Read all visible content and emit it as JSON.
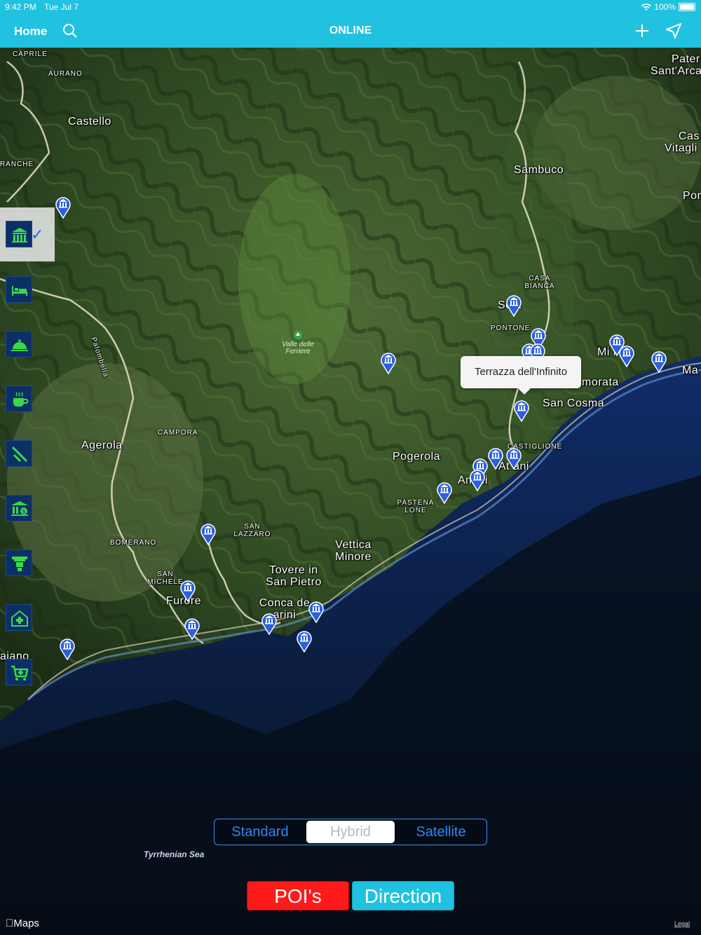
{
  "status_bar": {
    "time": "9:42 PM",
    "date": "Tue Jul 7",
    "battery": "100%"
  },
  "nav": {
    "home_label": "Home",
    "title": "ONLINE",
    "search_icon": "search-icon",
    "add_icon": "plus-icon",
    "locate_icon": "location-arrow-icon"
  },
  "map": {
    "labels": [
      {
        "text": "CAPRILE",
        "kind": "small"
      },
      {
        "text": "AURANO",
        "kind": "small"
      },
      {
        "text": "Castello",
        "kind": "big"
      },
      {
        "text": "RANCHE",
        "kind": "small"
      },
      {
        "text": "Sambuco",
        "kind": "big"
      },
      {
        "text": "Pater",
        "kind": "big"
      },
      {
        "text": "Sant'Arca",
        "kind": "big"
      },
      {
        "text": "Cas",
        "kind": "big"
      },
      {
        "text": "Vitagli",
        "kind": "big"
      },
      {
        "text": "Por",
        "kind": "big"
      },
      {
        "text": "CASA BIANCA",
        "kind": "small"
      },
      {
        "text": "Sc a",
        "kind": "big"
      },
      {
        "text": "PONTONE",
        "kind": "small"
      },
      {
        "text": "Mi  i",
        "kind": "big"
      },
      {
        "text": "Ma",
        "kind": "big"
      },
      {
        "text": "morata",
        "kind": "big"
      },
      {
        "text": "San Cosma",
        "kind": "big"
      },
      {
        "text": "CASTIGLIONE",
        "kind": "small"
      },
      {
        "text": "At ani",
        "kind": "big"
      },
      {
        "text": "Pogerola",
        "kind": "big"
      },
      {
        "text": "Am  lfi",
        "kind": "big"
      },
      {
        "text": "PASTENA LONE",
        "kind": "small"
      },
      {
        "text": "Agerola",
        "kind": "big"
      },
      {
        "text": "CAMPORA",
        "kind": "small"
      },
      {
        "text": "Palombella",
        "kind": "small"
      },
      {
        "text": "SAN LAZZARO",
        "kind": "small"
      },
      {
        "text": "BOMERANO",
        "kind": "small"
      },
      {
        "text": "Vettica Minore",
        "kind": "big"
      },
      {
        "text": "Tovere in San Pietro",
        "kind": "big"
      },
      {
        "text": "SAN MICHELE",
        "kind": "small"
      },
      {
        "text": "Furore",
        "kind": "big"
      },
      {
        "text": "Conca de  arini",
        "kind": "big"
      },
      {
        "text": "aiano",
        "kind": "big"
      }
    ],
    "park_label": "Valle delle Ferriere",
    "sea_label": "Tyrrhenian Sea",
    "callout_text": "Terrazza dell'Infinito"
  },
  "categories": [
    {
      "name": "museum-icon",
      "selected": true
    },
    {
      "name": "bed-icon",
      "selected": false
    },
    {
      "name": "restaurant-bell-icon",
      "selected": false
    },
    {
      "name": "coffee-icon",
      "selected": false
    },
    {
      "name": "fork-knife-icon",
      "selected": false
    },
    {
      "name": "bank-icon",
      "selected": false
    },
    {
      "name": "atm-icon",
      "selected": false
    },
    {
      "name": "hospital-icon",
      "selected": false
    },
    {
      "name": "shopping-cart-icon",
      "selected": false
    }
  ],
  "segment": {
    "options": [
      "Standard",
      "Hybrid",
      "Satellite"
    ],
    "selected": "Hybrid"
  },
  "buttons": {
    "pois": "POI's",
    "direction": "Direction"
  },
  "footer": {
    "maps_logo": "Maps",
    "legal": "Legal"
  },
  "colors": {
    "bar": "#20c2e0",
    "pin": "#2a5fe0",
    "category_bg": "#0c2f66",
    "category_icon": "#39d94a",
    "pois_button": "#ff1a1a",
    "segment": "#2d8af0"
  }
}
